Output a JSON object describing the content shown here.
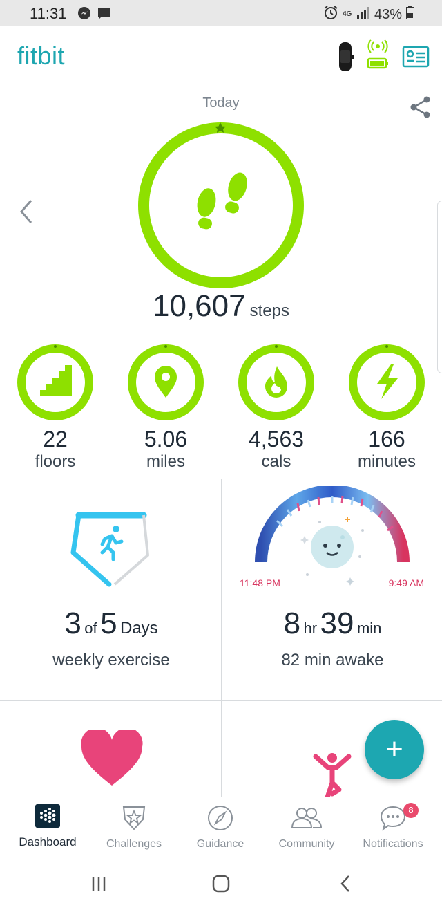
{
  "status_bar": {
    "time": "11:31",
    "battery": "43%",
    "network": "4G"
  },
  "header": {
    "logo": "fitbit"
  },
  "steps": {
    "day_label": "Today",
    "value": "10,607",
    "unit": "steps",
    "goal_progress": 1.0
  },
  "stats": [
    {
      "value": "22",
      "unit": "floors",
      "icon": "stairs-icon"
    },
    {
      "value": "5.06",
      "unit": "miles",
      "icon": "location-pin-icon"
    },
    {
      "value": "4,563",
      "unit": "cals",
      "icon": "flame-icon"
    },
    {
      "value": "166",
      "unit": "minutes",
      "icon": "lightning-icon"
    }
  ],
  "exercise": {
    "count": "3",
    "of": "of",
    "total": "5",
    "days_label": "Days",
    "subtitle": "weekly exercise"
  },
  "sleep": {
    "start_time": "11:48 PM",
    "end_time": "9:49 AM",
    "hours": "8",
    "hr_label": "hr",
    "minutes": "39",
    "min_label": "min",
    "subtitle": "82 min awake"
  },
  "fab": {
    "label": "+"
  },
  "bottom_nav": [
    {
      "label": "Dashboard",
      "icon": "dashboard-icon",
      "active": true
    },
    {
      "label": "Challenges",
      "icon": "challenges-icon"
    },
    {
      "label": "Guidance",
      "icon": "compass-icon"
    },
    {
      "label": "Community",
      "icon": "community-icon"
    },
    {
      "label": "Notifications",
      "icon": "chat-bubble-icon",
      "badge": "8"
    }
  ],
  "colors": {
    "accent_green": "#8ee000",
    "teal": "#1ea6b0",
    "exercise_blue": "#35c4ef",
    "heart_pink": "#e8447a",
    "sleep_red": "#d8345f"
  }
}
